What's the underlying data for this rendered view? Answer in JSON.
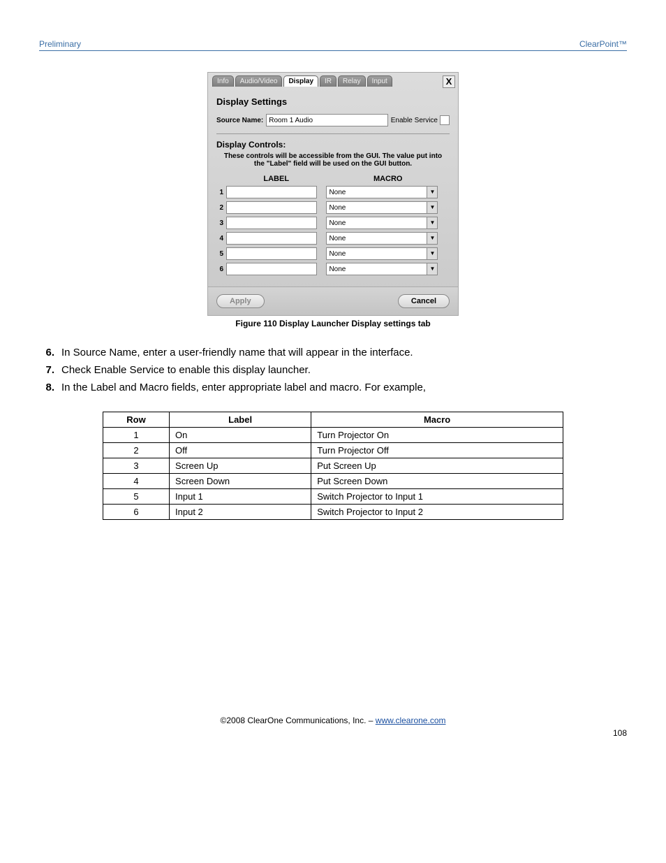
{
  "header": {
    "left": "Preliminary",
    "right": "ClearPoint™"
  },
  "dialog": {
    "tabs": [
      "Info",
      "Audio/Video",
      "Display",
      "IR",
      "Relay",
      "Input"
    ],
    "active_tab": "Display",
    "close": "X",
    "title": "Display Settings",
    "source_name_label": "Source Name:",
    "source_name_value": "Room 1 Audio",
    "enable_service_label": "Enable Service",
    "controls_title": "Display Controls:",
    "controls_desc": "These controls will be accessible from the GUI.  The value put into the \"Label\" field will be used on the GUI button.",
    "col_label": "LABEL",
    "col_macro": "MACRO",
    "rows": [
      {
        "n": "1",
        "label": "",
        "macro": "None"
      },
      {
        "n": "2",
        "label": "",
        "macro": "None"
      },
      {
        "n": "3",
        "label": "",
        "macro": "None"
      },
      {
        "n": "4",
        "label": "",
        "macro": "None"
      },
      {
        "n": "5",
        "label": "",
        "macro": "None"
      },
      {
        "n": "6",
        "label": "",
        "macro": "None"
      }
    ],
    "apply": "Apply",
    "cancel": "Cancel"
  },
  "figure_caption": "Figure 110 Display Launcher Display settings tab",
  "steps": [
    {
      "n": "6.",
      "text": "In Source Name, enter a user-friendly name that will appear in the interface."
    },
    {
      "n": "7.",
      "text": "Check Enable Service to enable this display launcher."
    },
    {
      "n": "8.",
      "text": "In the Label and Macro fields, enter appropriate label and macro. For example,"
    }
  ],
  "table": {
    "headers": [
      "Row",
      "Label",
      "Macro"
    ],
    "rows": [
      {
        "row": "1",
        "label": "On",
        "macro": "Turn Projector On"
      },
      {
        "row": "2",
        "label": "Off",
        "macro": "Turn Projector Off"
      },
      {
        "row": "3",
        "label": "Screen Up",
        "macro": "Put Screen Up"
      },
      {
        "row": "4",
        "label": "Screen Down",
        "macro": "Put Screen Down"
      },
      {
        "row": "5",
        "label": "Input 1",
        "macro": "Switch Projector to Input 1"
      },
      {
        "row": "6",
        "label": "Input 2",
        "macro": "Switch Projector to Input 2"
      }
    ]
  },
  "footer": {
    "copyright": "©2008 ClearOne Communications, Inc. – ",
    "link": "www.clearone.com",
    "page": "108"
  }
}
